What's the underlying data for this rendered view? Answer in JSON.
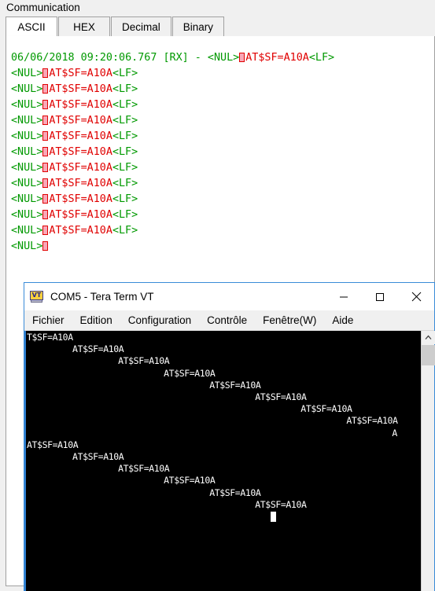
{
  "group": {
    "label": "Communication"
  },
  "tabs": [
    {
      "label": "ASCII",
      "selected": true
    },
    {
      "label": "HEX",
      "selected": false
    },
    {
      "label": "Decimal",
      "selected": false
    },
    {
      "label": "Binary",
      "selected": false
    }
  ],
  "log": {
    "first_line": {
      "timestamp": "06/06/2018 09:20:06.767 [RX] - ",
      "nul": "<NUL>",
      "command": "AT$SF=A10A",
      "lf": "<LF>"
    },
    "repeat_line": {
      "nul": "<NUL>",
      "command": "AT$SF=A10A",
      "lf": "<LF>"
    },
    "repeat_count": 11,
    "last_line": {
      "nul": "<NUL>"
    },
    "colors": {
      "control": "#009900",
      "payload": "#e00000",
      "background": "#ffffff"
    }
  },
  "teraterm": {
    "icon": "vt-terminal-icon",
    "title": "COM5 - Tera Term VT",
    "window_buttons": [
      {
        "name": "minimize",
        "glyph": "minimize-icon"
      },
      {
        "name": "maximize",
        "glyph": "maximize-icon"
      },
      {
        "name": "close",
        "glyph": "close-icon"
      }
    ],
    "menu": [
      "Fichier",
      "Edition",
      "Configuration",
      "Contrôle",
      "Fenêtre(W)",
      "Aide"
    ],
    "screen": {
      "background": "#000000",
      "foreground": "#ffffff",
      "lines": [
        {
          "text": "T$SF=A10A",
          "col": 0
        },
        {
          "text": "AT$SF=A10A",
          "col": 9
        },
        {
          "text": "AT$SF=A10A",
          "col": 18
        },
        {
          "text": "AT$SF=A10A",
          "col": 27
        },
        {
          "text": "AT$SF=A10A",
          "col": 36
        },
        {
          "text": "AT$SF=A10A",
          "col": 45
        },
        {
          "text": "AT$SF=A10A",
          "col": 54
        },
        {
          "text": "AT$SF=A10A",
          "col": 63
        },
        {
          "text": "A",
          "col": 72
        },
        {
          "text": "AT$SF=A10A",
          "col": 0
        },
        {
          "text": "AT$SF=A10A",
          "col": 9
        },
        {
          "text": "AT$SF=A10A",
          "col": 18
        },
        {
          "text": "AT$SF=A10A",
          "col": 27
        },
        {
          "text": "AT$SF=A10A",
          "col": 36
        },
        {
          "text": "AT$SF=A10A",
          "col": 45
        }
      ],
      "cursor": {
        "col": 48,
        "row": 15
      }
    },
    "scrollbar": {
      "up_arrow": "chevron-up-icon",
      "thumb_position": "top"
    }
  }
}
